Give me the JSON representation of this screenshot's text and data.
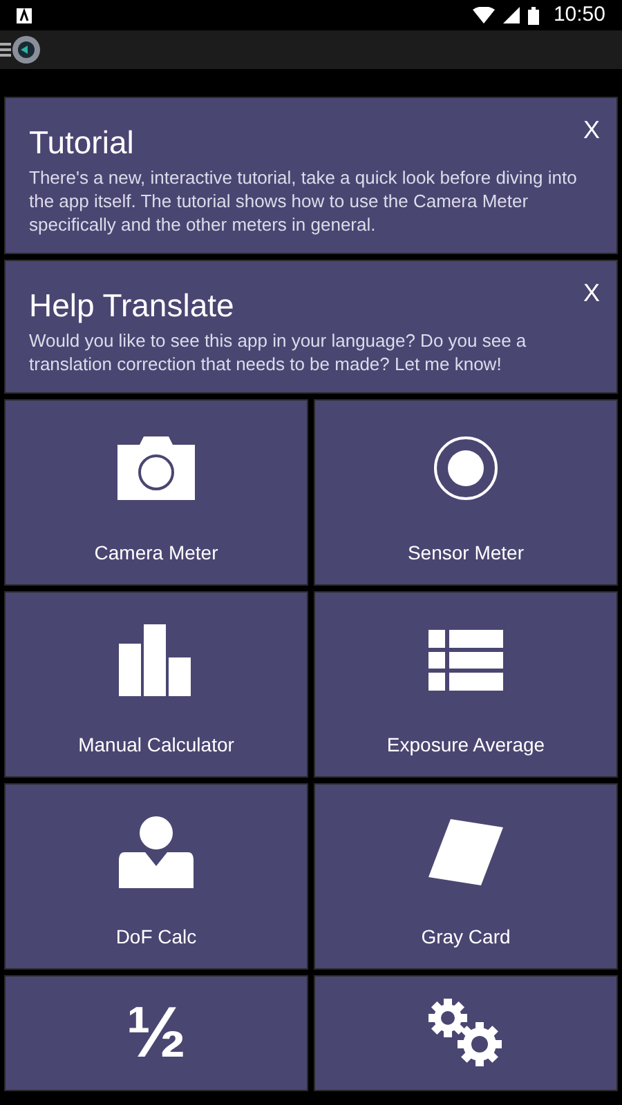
{
  "status_bar": {
    "time": "10:50"
  },
  "cards": [
    {
      "title": "Tutorial",
      "body": "There's a new, interactive tutorial, take a quick look before diving into the app itself. The tutorial shows how to use the Camera Meter specifically and the other meters in general.",
      "close": "X"
    },
    {
      "title": "Help Translate",
      "body": "Would you like to see this app in your language? Do you see a translation correction that needs to be made? Let me know!",
      "close": "X"
    }
  ],
  "tiles": [
    {
      "kind": "camera",
      "label": "Camera Meter"
    },
    {
      "kind": "sensor",
      "label": "Sensor Meter"
    },
    {
      "kind": "bars",
      "label": "Manual Calculator"
    },
    {
      "kind": "list",
      "label": "Exposure Average"
    },
    {
      "kind": "person",
      "label": "DoF Calc"
    },
    {
      "kind": "card",
      "label": "Gray Card"
    },
    {
      "kind": "fraction",
      "glyph": "½"
    },
    {
      "kind": "gears"
    }
  ]
}
